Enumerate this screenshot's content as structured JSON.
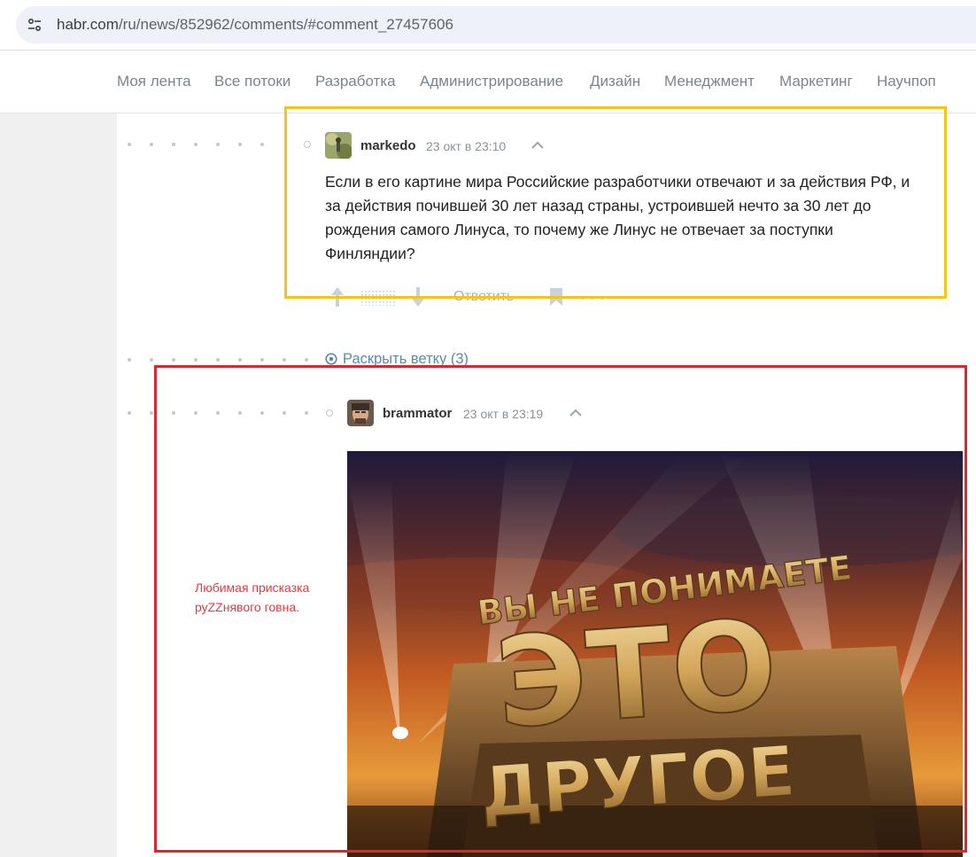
{
  "browser": {
    "url_host": "habr.com",
    "url_path": "/ru/news/852962/comments/#comment_27457606",
    "site_info_icon": "tune-icon"
  },
  "nav": {
    "items": [
      "Моя лента",
      "Все потоки",
      "Разработка",
      "Администрирование",
      "Дизайн",
      "Менеджмент",
      "Маркетинг",
      "Научпоп"
    ]
  },
  "comment1": {
    "username": "markedo",
    "time": "23 окт в 23:10",
    "text": "Если в его картине мира Российские разработчики отвечают и за действия РФ, и\nза действия почившей 30 лет назад страны, устроившей нечто за 30 лет до\nрождения самого Линуса, то почему же Линус не отвечает за поступки\nФинляндии?",
    "reply_label": "Ответить"
  },
  "thread": {
    "expand_label": "Раскрыть ветку (3)"
  },
  "comment2": {
    "username": "brammator",
    "time": "23 окт в 23:19",
    "meme": {
      "top_line": "ВЫ НЕ ПОНИМАЕТЕ",
      "middle": "ЭТО",
      "bottom": "ДРУГОЕ"
    }
  },
  "annotation": {
    "note": "Любимая присказка\nруZZнявого говна.",
    "colors": {
      "yellow_box": "#f2c51d",
      "red_box": "#e0262c",
      "note": "#e53a3f"
    }
  }
}
